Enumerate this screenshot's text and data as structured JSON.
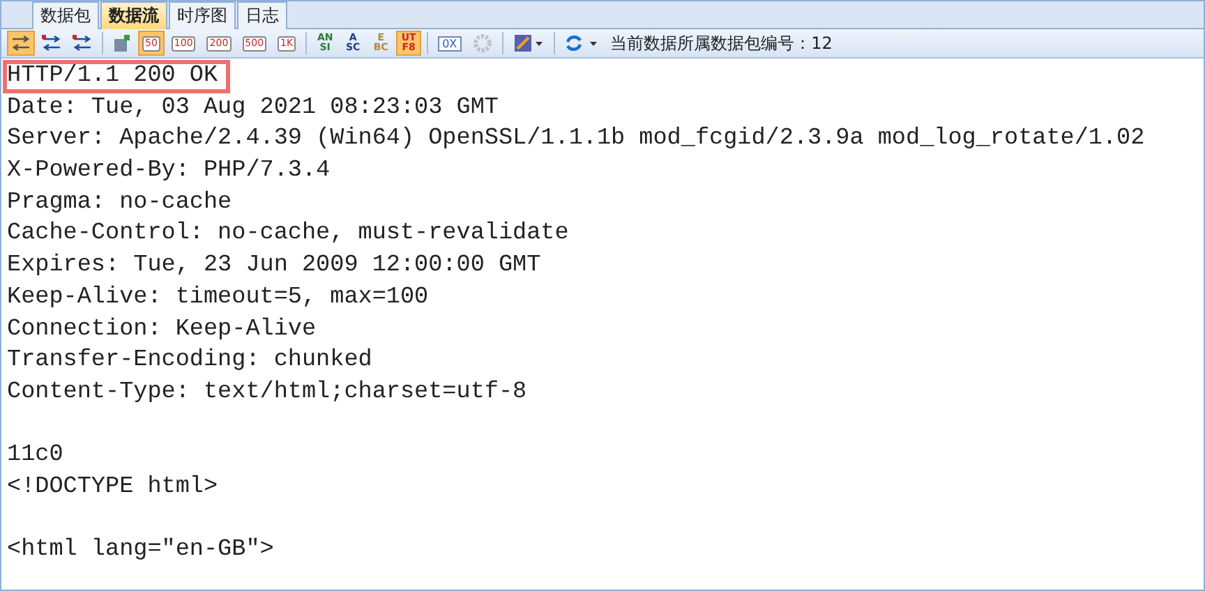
{
  "tabs": [
    {
      "label": "数据包",
      "selected": false
    },
    {
      "label": "数据流",
      "selected": true
    },
    {
      "label": "时序图",
      "selected": false
    },
    {
      "label": "日志",
      "selected": false
    }
  ],
  "toolbar": [
    {
      "kind": "swap",
      "selected": true
    },
    {
      "kind": "swap12",
      "selected": false
    },
    {
      "kind": "swap21",
      "selected": false
    },
    {
      "kind": "sep"
    },
    {
      "kind": "db",
      "selected": false
    },
    {
      "kind": "count",
      "label": "50",
      "selected": true
    },
    {
      "kind": "count",
      "label": "100",
      "selected": false
    },
    {
      "kind": "count",
      "label": "200",
      "selected": false
    },
    {
      "kind": "count",
      "label": "500",
      "selected": false
    },
    {
      "kind": "count",
      "label": "1K",
      "selected": false
    },
    {
      "kind": "sep"
    },
    {
      "kind": "enc",
      "lines": [
        "AN",
        "SI"
      ],
      "color": "#2e7d32",
      "selected": false
    },
    {
      "kind": "enc",
      "lines": [
        "A",
        "SC"
      ],
      "color": "#1a3e8c",
      "selected": false
    },
    {
      "kind": "enc",
      "lines": [
        "E",
        "BC"
      ],
      "color": "#b08a3a",
      "selected": false
    },
    {
      "kind": "enc",
      "lines": [
        "UT",
        "F8"
      ],
      "color": "#c62828",
      "selected": true
    },
    {
      "kind": "sep"
    },
    {
      "kind": "hex",
      "label": "0X",
      "selected": false
    },
    {
      "kind": "gear",
      "disabled": true
    },
    {
      "kind": "sep"
    },
    {
      "kind": "image"
    },
    {
      "kind": "sep"
    },
    {
      "kind": "refresh"
    },
    {
      "kind": "label",
      "label": "当前数据所属数据包编号：12"
    }
  ],
  "lines": [
    {
      "text": "HTTP/1.1 200 OK",
      "highlighted": true
    },
    {
      "text": "Date: Tue, 03 Aug 2021 08:23:03 GMT"
    },
    {
      "text": "Server: Apache/2.4.39 (Win64) OpenSSL/1.1.1b mod_fcgid/2.3.9a mod_log_rotate/1.02"
    },
    {
      "text": "X-Powered-By: PHP/7.3.4"
    },
    {
      "text": "Pragma: no-cache"
    },
    {
      "text": "Cache-Control: no-cache, must-revalidate"
    },
    {
      "text": "Expires: Tue, 23 Jun 2009 12:00:00 GMT"
    },
    {
      "text": "Keep-Alive: timeout=5, max=100"
    },
    {
      "text": "Connection: Keep-Alive"
    },
    {
      "text": "Transfer-Encoding: chunked"
    },
    {
      "text": "Content-Type: text/html;charset=utf-8"
    },
    {
      "text": "11c0",
      "blank_before": true
    },
    {
      "text": "<!DOCTYPE html>"
    },
    {
      "text": "<html lang=\"en-GB\">",
      "blank_before": true
    }
  ]
}
